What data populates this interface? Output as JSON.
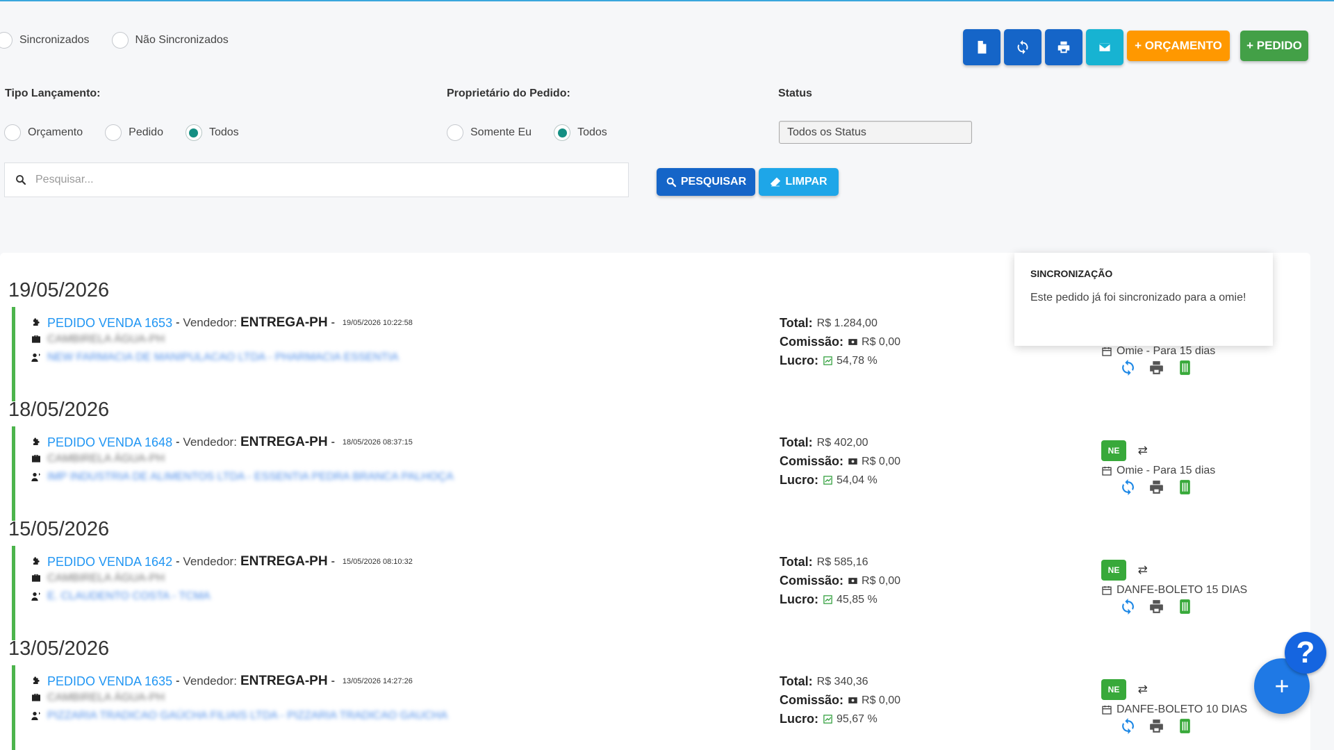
{
  "filters": {
    "sync_options": [
      "Sincronizados",
      "Não Sincronizados"
    ],
    "tipo_label": "Tipo Lançamento:",
    "tipo_options": [
      "Orçamento",
      "Pedido",
      "Todos"
    ],
    "tipo_selected": "Todos",
    "proprietario_label": "Proprietário do Pedido:",
    "proprietario_options": [
      "Somente Eu",
      "Todos"
    ],
    "proprietario_selected": "Todos",
    "status_label": "Status",
    "status_value": "Todos os Status"
  },
  "toolbar": {
    "orcamento_label": "+ ORÇAMENTO",
    "pedido_label": "+ PEDIDO",
    "colors": {
      "blue": "#1565c8",
      "cyan": "#17b3d2",
      "orange": "#ff9800",
      "green": "#43a047"
    }
  },
  "search": {
    "placeholder": "Pesquisar...",
    "search_label": "PESQUISAR",
    "clear_label": "LIMPAR"
  },
  "tooltip": {
    "title": "SINCRONIZAÇÃO",
    "body": "Este pedido já foi sincronizado para a omie!"
  },
  "labels": {
    "vendedor": "Vendedor:",
    "total": "Total:",
    "comissao": "Comissão:",
    "lucro": "Lucro:",
    "ne_badge": "NE"
  },
  "groups": [
    {
      "date": "19/05/2026",
      "order": {
        "title": "PEDIDO VENDA 1653",
        "vendor": "ENTREGA-PH",
        "timestamp": "19/05/2026 10:22:58",
        "company": "CAMBIRELA ÁGUA-PH",
        "client": "NEW FARMACIA DE MANIPULACAO LTDA - PHARMACIA ESSENTIA",
        "total": "R$ 1.284,00",
        "comissao": "R$ 0,00",
        "lucro": "54,78 %",
        "payment": "Omie - Para 15 dias"
      }
    },
    {
      "date": "18/05/2026",
      "order": {
        "title": "PEDIDO VENDA 1648",
        "vendor": "ENTREGA-PH",
        "timestamp": "18/05/2026 08:37:15",
        "company": "CAMBIRELA ÁGUA-PH",
        "client": "IMP INDUSTRIA DE ALIMENTOS LTDA - ESSENTIA PEDRA BRANCA PALHOÇA",
        "total": "R$ 402,00",
        "comissao": "R$ 0,00",
        "lucro": "54,04 %",
        "payment": "Omie - Para 15 dias"
      }
    },
    {
      "date": "15/05/2026",
      "order": {
        "title": "PEDIDO VENDA 1642",
        "vendor": "ENTREGA-PH",
        "timestamp": "15/05/2026 08:10:32",
        "company": "CAMBIRELA ÁGUA-PH",
        "client": "E. CLAUDENTO COSTA - TCMA",
        "total": "R$ 585,16",
        "comissao": "R$ 0,00",
        "lucro": "45,85 %",
        "payment": "DANFE-BOLETO 15 DIAS"
      }
    },
    {
      "date": "13/05/2026",
      "order": {
        "title": "PEDIDO VENDA 1635",
        "vendor": "ENTREGA-PH",
        "timestamp": "13/05/2026 14:27:26",
        "company": "CAMBIRELA ÁGUA-PH",
        "client": "PIZZARIA TRADICAO GAÚCHA FILIAIS LTDA - PIZZARIA TRADICAO GAUCHA",
        "total": "R$ 340,36",
        "comissao": "R$ 0,00",
        "lucro": "95,67 %",
        "payment": "DANFE-BOLETO 10 DIAS"
      }
    }
  ],
  "help_label": "?",
  "fab_label": "+"
}
